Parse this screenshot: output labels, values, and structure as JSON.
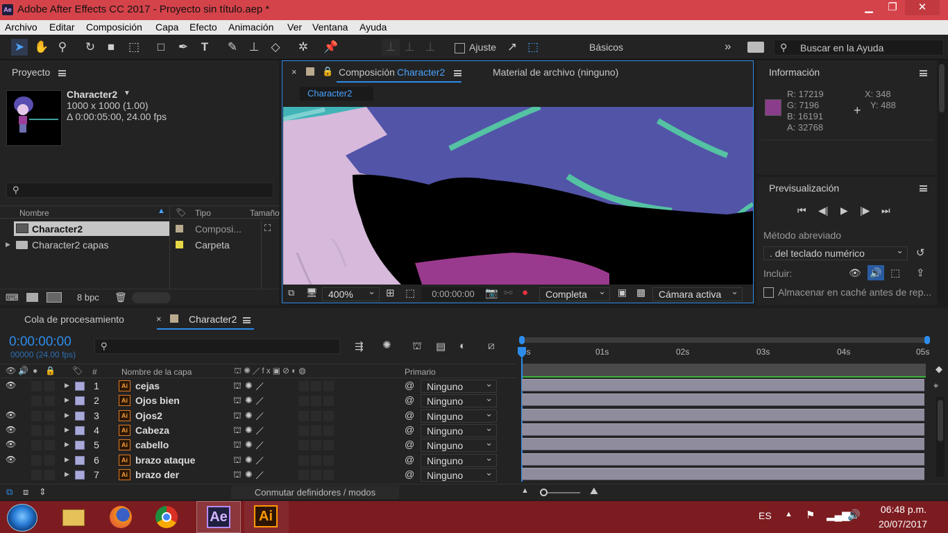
{
  "window": {
    "title": "Adobe After Effects CC 2017 - Proyecto sin título.aep *",
    "logo": "Ae"
  },
  "menu": [
    "Archivo",
    "Editar",
    "Composición",
    "Capa",
    "Efecto",
    "Animación",
    "Ver",
    "Ventana",
    "Ayuda"
  ],
  "toolbar": {
    "snap_label": "Ajuste",
    "workspace": "Básicos",
    "search_placeholder": "Buscar en la Ayuda"
  },
  "project": {
    "title": "Proyecto",
    "comp_name": "Character2",
    "comp_size": "1000 x 1000 (1.00)",
    "comp_duration": "Δ 0:00:05:00, 24.00 fps",
    "columns": {
      "name": "Nombre",
      "type": "Tipo",
      "size": "Tamaño"
    },
    "items": [
      {
        "name": "Character2",
        "type": "Composi..."
      },
      {
        "name": "Character2 capas",
        "type": "Carpeta"
      }
    ],
    "bpc": "8 bpc"
  },
  "composition": {
    "tab_prefix": "Composición",
    "tab_name": "Character2",
    "footage_tab": "Material de archivo (ninguno)",
    "breadcrumb": "Character2",
    "zoom": "400%",
    "timecode": "0:00:00:00",
    "resolution": "Completa",
    "camera": "Cámara activa"
  },
  "info": {
    "title": "Información",
    "r": "R:  17219",
    "g": "G:  7196",
    "b": "B:  16191",
    "a": "A:  32768",
    "x": "X:  348",
    "y": "Y:  488",
    "swatch": "#8a3d8a"
  },
  "preview": {
    "title": "Previsualización",
    "shortcut_label": "Método abreviado",
    "shortcut_value": ". del teclado numérico",
    "include_label": "Incluir:",
    "cache_label": "Almacenar en caché antes de rep..."
  },
  "timeline": {
    "render_queue_tab": "Cola de procesamiento",
    "comp_tab": "Character2",
    "timecode": "0:00:00:00",
    "frame_info": "00000 (24.00 fps)",
    "headers": {
      "hash": "#",
      "layer_name": "Nombre de la capa",
      "parent": "Primario"
    },
    "ruler": [
      "0s",
      "01s",
      "02s",
      "03s",
      "04s",
      "05s"
    ],
    "toggle_label": "Conmutar definidores / modos",
    "layers": [
      {
        "num": "1",
        "name": "cejas",
        "parent": "Ninguno",
        "visible": true
      },
      {
        "num": "2",
        "name": "Ojos bien",
        "parent": "Ninguno",
        "visible": false
      },
      {
        "num": "3",
        "name": "Ojos2",
        "parent": "Ninguno",
        "visible": true
      },
      {
        "num": "4",
        "name": "Cabeza",
        "parent": "Ninguno",
        "visible": true
      },
      {
        "num": "5",
        "name": "cabello",
        "parent": "Ninguno",
        "visible": true
      },
      {
        "num": "6",
        "name": "brazo ataque",
        "parent": "Ninguno",
        "visible": true
      },
      {
        "num": "7",
        "name": "brazo der",
        "parent": "Ninguno",
        "visible": false
      }
    ]
  },
  "taskbar": {
    "lang": "ES",
    "time": "06:48 p.m.",
    "date": "20/07/2017",
    "ae": "Ae",
    "ai": "Ai"
  },
  "colors": {
    "accent": "#2d8ceb",
    "titlebar": "#d5434a",
    "taskbar": "#7c1c20"
  }
}
